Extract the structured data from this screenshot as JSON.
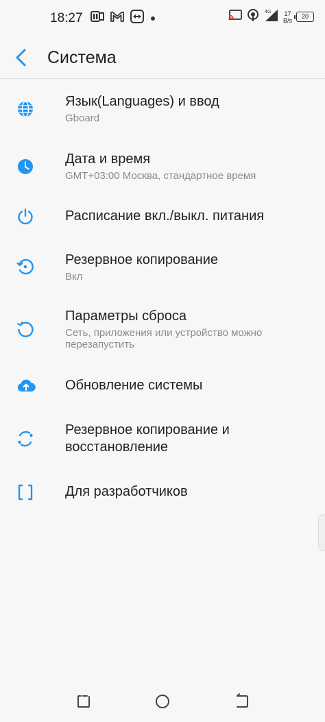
{
  "status_bar": {
    "time": "18:27",
    "net_speed_value": "17",
    "net_speed_unit": "B/s",
    "network": "4G",
    "battery": "20"
  },
  "header": {
    "title": "Система"
  },
  "items": [
    {
      "title": "Язык(Languages) и ввод",
      "subtitle": "Gboard",
      "icon": "globe-icon"
    },
    {
      "title": "Дата и время",
      "subtitle": "GMT+03:00 Москва, стандартное время",
      "icon": "clock-icon"
    },
    {
      "title": "Расписание вкл./выкл. питания",
      "subtitle": "",
      "icon": "power-icon"
    },
    {
      "title": "Резервное копирование",
      "subtitle": "Вкл",
      "icon": "backup-icon"
    },
    {
      "title": "Параметры сброса",
      "subtitle": "Сеть, приложения или устройство можно перезапустить",
      "icon": "reset-icon"
    },
    {
      "title": "Обновление системы",
      "subtitle": "",
      "icon": "cloud-upload-icon"
    },
    {
      "title": "Резервное копирование и восстановление",
      "subtitle": "",
      "icon": "sync-icon"
    },
    {
      "title": "Для разработчиков",
      "subtitle": "",
      "icon": "braces-icon"
    }
  ],
  "colors": {
    "accent": "#2196f3",
    "background": "#f7f7f7"
  }
}
